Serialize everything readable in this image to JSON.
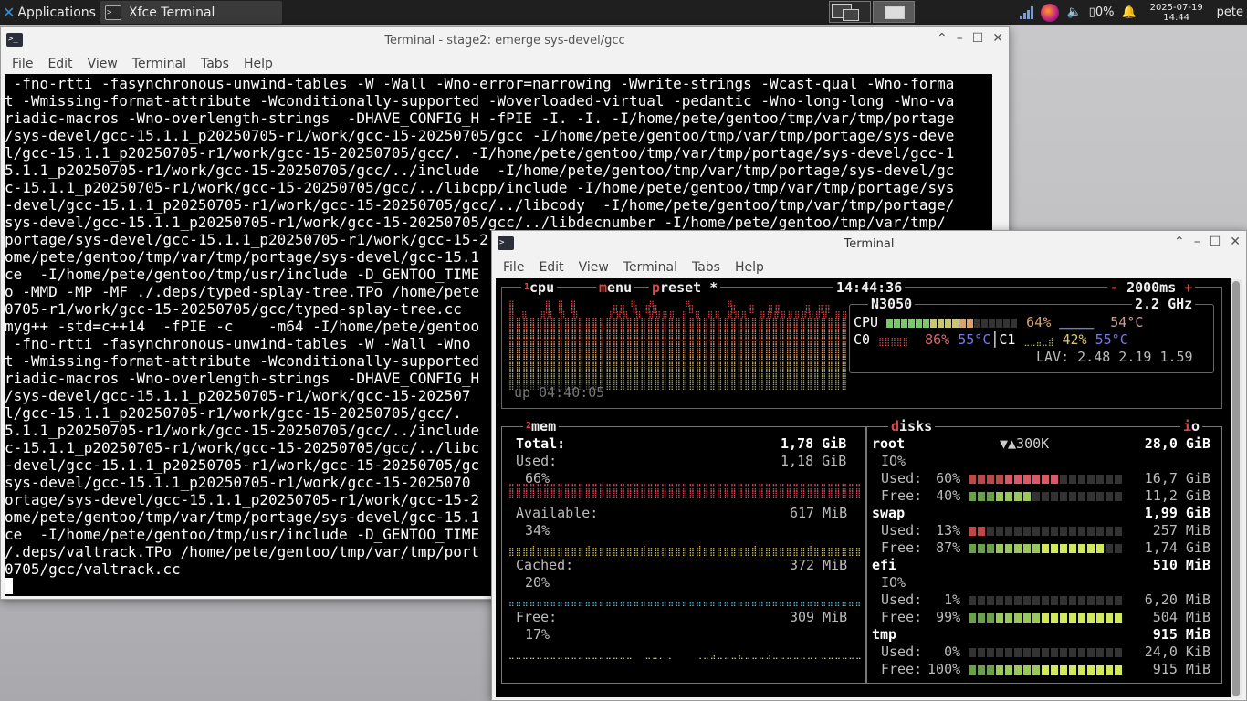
{
  "panel": {
    "apps_label": "Applications",
    "task_label": "Xfce Terminal",
    "task_badge": "2",
    "battery": "0%",
    "date": "2025-07-19",
    "time": "14:44",
    "user": "pete"
  },
  "win1": {
    "title": "Terminal - stage2: emerge sys-devel/gcc",
    "menu": [
      "File",
      "Edit",
      "View",
      "Terminal",
      "Tabs",
      "Help"
    ],
    "lines": [
      " -fno-rtti -fasynchronous-unwind-tables -W -Wall -Wno-error=narrowing -Wwrite-strings -Wcast-qual -Wno-forma",
      "t -Wmissing-format-attribute -Wconditionally-supported -Woverloaded-virtual -pedantic -Wno-long-long -Wno-va",
      "riadic-macros -Wno-overlength-strings  -DHAVE_CONFIG_H -fPIE -I. -I. -I/home/pete/gentoo/tmp/var/tmp/portage",
      "/sys-devel/gcc-15.1.1_p20250705-r1/work/gcc-15-20250705/gcc -I/home/pete/gentoo/tmp/var/tmp/portage/sys-deve",
      "l/gcc-15.1.1_p20250705-r1/work/gcc-15-20250705/gcc/. -I/home/pete/gentoo/tmp/var/tmp/portage/sys-devel/gcc-1",
      "5.1.1_p20250705-r1/work/gcc-15-20250705/gcc/../include  -I/home/pete/gentoo/tmp/var/tmp/portage/sys-devel/gc",
      "c-15.1.1_p20250705-r1/work/gcc-15-20250705/gcc/../libcpp/include -I/home/pete/gentoo/tmp/var/tmp/portage/sys",
      "-devel/gcc-15.1.1_p20250705-r1/work/gcc-15-20250705/gcc/../libcody  -I/home/pete/gentoo/tmp/var/tmp/portage/",
      "sys-devel/gcc-15.1.1_p20250705-r1/work/gcc-15-20250705/gcc/../libdecnumber -I/home/pete/gentoo/tmp/var/tmp/",
      "portage/sys-devel/gcc-15.1.1_p20250705-r1/work/gcc-15-2",
      "ome/pete/gentoo/tmp/var/tmp/portage/sys-devel/gcc-15.1",
      "ce  -I/home/pete/gentoo/tmp/usr/include -D_GENTOO_TIME",
      "o -MMD -MP -MF ./.deps/typed-splay-tree.TPo /home/pete",
      "0705-r1/work/gcc-15-20250705/gcc/typed-splay-tree.cc",
      "myg++ -std=c++14  -fPIE -c    -m64 -I/home/pete/gentoo",
      " -fno-rtti -fasynchronous-unwind-tables -W -Wall -Wno",
      "t -Wmissing-format-attribute -Wconditionally-supported",
      "riadic-macros -Wno-overlength-strings  -DHAVE_CONFIG_H",
      "/sys-devel/gcc-15.1.1_p20250705-r1/work/gcc-15-202507",
      "l/gcc-15.1.1_p20250705-r1/work/gcc-15-20250705/gcc/.",
      "5.1.1_p20250705-r1/work/gcc-15-20250705/gcc/../include",
      "c-15.1.1_p20250705-r1/work/gcc-15-20250705/gcc/../libc",
      "-devel/gcc-15.1.1_p20250705-r1/work/gcc-15-20250705/gc",
      "sys-devel/gcc-15.1.1_p20250705-r1/work/gcc-15-2025070",
      "ortage/sys-devel/gcc-15.1.1_p20250705-r1/work/gcc-15-2",
      "ome/pete/gentoo/tmp/var/tmp/portage/sys-devel/gcc-15.1",
      "ce  -I/home/pete/gentoo/tmp/usr/include -D_GENTOO_TIME",
      "/.deps/valtrack.TPo /home/pete/gentoo/tmp/var/tmp/port",
      "0705/gcc/valtrack.cc"
    ]
  },
  "win2": {
    "title": "Terminal",
    "menu": [
      "File",
      "Edit",
      "View",
      "Terminal",
      "Tabs",
      "Help"
    ]
  },
  "btop": {
    "cpu_box": {
      "cpu_num": "1",
      "cpu_label": "cpu",
      "menu_hl": "m",
      "menu_rest": "enu",
      "preset_hl": "p",
      "preset_rest": "reset *",
      "clock": "14:44:36",
      "minus": "-",
      "interval": "2000ms",
      "plus": "+",
      "uptime": "up 04:40:05"
    },
    "cpu_info": {
      "model": "N3050",
      "freq": "2.2 GHz",
      "cpu_label": "CPU",
      "cpu_pct": "64%",
      "cpu_temp": "54°C",
      "cpu_pct_value": 64,
      "c0_label": "C0",
      "c0_pct": "86%",
      "c0_temp": "55°C",
      "c1_label": "C1",
      "c1_pct": "42%",
      "c1_temp": "55°C",
      "lav": "LAV: 2.48 2.19 1.59"
    },
    "mem": {
      "num": "2",
      "label": "mem",
      "total_label": "Total:",
      "total": "1,78 GiB",
      "used_label": "Used:",
      "used": "1,18 GiB",
      "used_pct": "66%",
      "avail_label": "Available:",
      "avail": "617 MiB",
      "avail_pct": "34%",
      "cached_label": "Cached:",
      "cached": "372 MiB",
      "cached_pct": "20%",
      "free_label": "Free:",
      "free": "309 MiB",
      "free_pct": "17%"
    },
    "disks": {
      "hl": "d",
      "rest": "isks",
      "io_hl": "i",
      "io_rest": "o",
      "root_name": "root",
      "root_io": "▼▲300K",
      "root_size": "28,0 GiB",
      "root_io_label": "IO%",
      "root_used_label": "Used:",
      "root_used_pct": "60%",
      "root_used": "16,7 GiB",
      "root_used_value": 60,
      "root_free_label": "Free:",
      "root_free_pct": "40%",
      "root_free": "11,2 GiB",
      "root_free_value": 40,
      "swap_name": "swap",
      "swap_size": "1,99 GiB",
      "swap_used_label": "Used:",
      "swap_used_pct": "13%",
      "swap_used": "257 MiB",
      "swap_used_value": 13,
      "swap_free_label": "Free:",
      "swap_free_pct": "87%",
      "swap_free": "1,74 GiB",
      "swap_free_value": 87,
      "efi_name": "efi",
      "efi_size": "510 MiB",
      "efi_io_label": "IO%",
      "efi_used_label": "Used:",
      "efi_used_pct": "1%",
      "efi_used": "6,20 MiB",
      "efi_used_value": 1,
      "efi_free_label": "Free:",
      "efi_free_pct": "99%",
      "efi_free": "504 MiB",
      "efi_free_value": 99,
      "tmp_name": "tmp",
      "tmp_size": "915 MiB",
      "tmp_used_label": "Used:",
      "tmp_used_pct": "0%",
      "tmp_used": "24,0 KiB",
      "tmp_used_value": 0,
      "tmp_free_label": "Free:",
      "tmp_free_pct": "100%",
      "tmp_free": "915 MiB",
      "tmp_free_value": 100
    }
  }
}
